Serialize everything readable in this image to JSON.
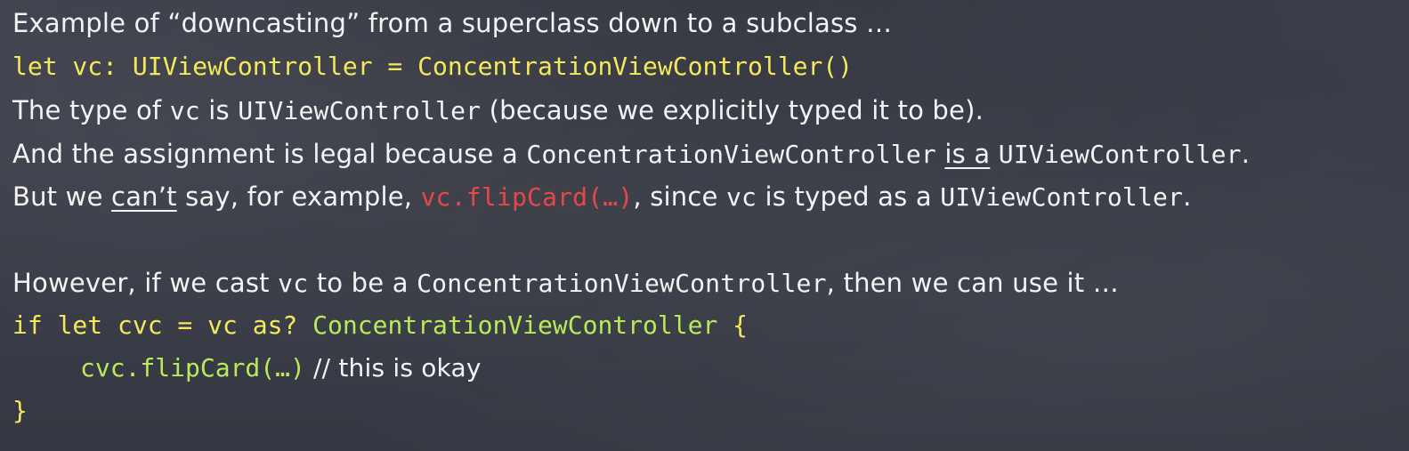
{
  "slide": {
    "line1": {
      "text": "Example of “downcasting” from a superclass down to a subclass …"
    },
    "line2": {
      "code": "let vc: UIViewController = ConcentrationViewController()"
    },
    "line3": {
      "p1": "The type of ",
      "code1": "vc",
      "p2": " is ",
      "code2": "UIViewController",
      "p3": " (because we explicitly typed it to be)."
    },
    "line4": {
      "p1": "And the assignment is legal because a ",
      "code1": "ConcentrationViewController",
      "p2": " ",
      "emph": "is a",
      "p3": " ",
      "code2": "UIViewController",
      "p4": "."
    },
    "line5": {
      "p1": "But we ",
      "emph": "can’t",
      "p2": " say, for example, ",
      "code_red": "vc.flipCard(…)",
      "p3": ", since ",
      "code1": "vc",
      "p4": " is typed as a ",
      "code2": "UIViewController",
      "p5": "."
    },
    "line6": {
      "p1": "However, if we cast ",
      "code1": "vc",
      "p2": " to be a ",
      "code2": "ConcentrationViewController",
      "p3": ", then we can use it …"
    },
    "line7": {
      "kw": "if let cvc = vc as? ",
      "type": "ConcentrationViewController",
      "brace": " {"
    },
    "line8": {
      "code": "cvc.flipCard(…)",
      "comment": " // this is okay"
    },
    "line9": {
      "brace": "}"
    }
  },
  "colors": {
    "background": "#3a3d47",
    "text": "#f3f3f3",
    "code_yellow": "#f3e95a",
    "code_red": "#e8474a",
    "code_green": "#b9ea5b"
  }
}
